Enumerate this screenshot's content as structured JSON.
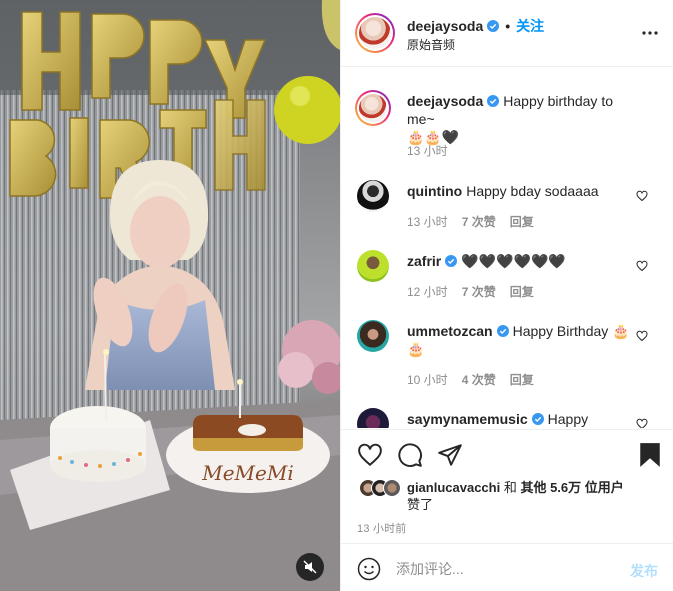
{
  "media": {
    "balloon_text": "HAPPY BIRTHDAY",
    "cake_text": "MeMeMi",
    "mute_icon": "speaker-muted-icon"
  },
  "header": {
    "username": "deejaysoda",
    "separator": "•",
    "follow_label": "关注",
    "subtitle": "原始音频",
    "more_icon": "more-horizontal-icon"
  },
  "caption": {
    "username": "deejaysoda",
    "text": "Happy birthday to me~",
    "text2": "🎂🎂🖤",
    "time": "13 小时"
  },
  "comments": [
    {
      "username": "quintino",
      "text": "Happy bday sodaaaa",
      "time": "13 小时",
      "likes": "7 次赞",
      "reply": "回复"
    },
    {
      "username": "zafrir",
      "verified": true,
      "text": "🖤🖤🖤🖤🖤🖤",
      "time": "12 小时",
      "likes": "7 次赞",
      "reply": "回复"
    },
    {
      "username": "ummetozcan",
      "verified": true,
      "text": "Happy Birthday 🎂",
      "text2": "🎂",
      "time": "10 小时",
      "likes": "4 次赞",
      "reply": "回复"
    },
    {
      "username": "saymynamemusic",
      "verified": true,
      "text": "Happy"
    }
  ],
  "likes": {
    "liker": "gianlucavacchi",
    "and": " 和 ",
    "others": "其他 5.6万 位用户",
    "suffix": "赞了"
  },
  "post_time": "13 小时前",
  "add_comment": {
    "placeholder": "添加评论...",
    "post_label": "发布"
  },
  "colors": {
    "accent": "#0095f6",
    "verified": "#3897f0",
    "post_disabled": "#b2dffc"
  }
}
